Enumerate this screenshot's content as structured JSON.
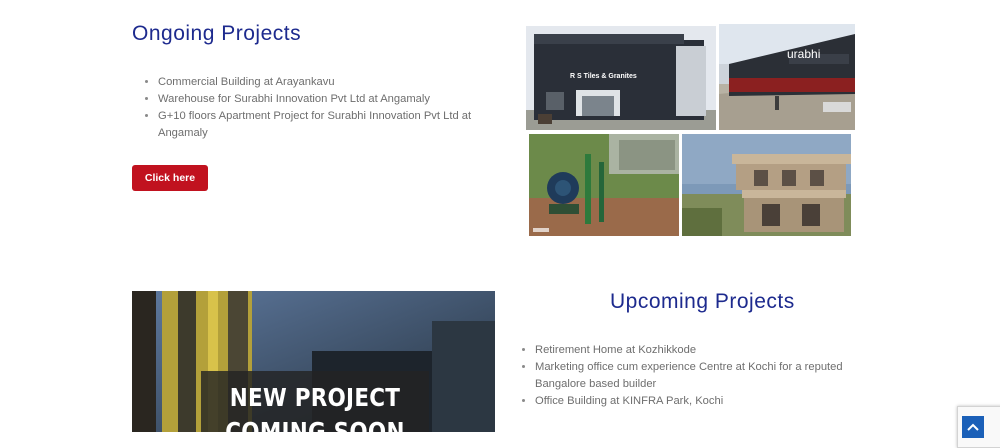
{
  "ongoing": {
    "title": "Ongoing Projects",
    "items": [
      "Commercial Building at Arayankavu",
      "Warehouse for Surabhi Innovation Pvt Ltd at Angamaly",
      "G+10 floors Apartment Project for Surabhi Innovation Pvt Ltd at Angamaly"
    ],
    "button_label": "Click here"
  },
  "gallery": {
    "showroom_sign": "R S Tiles & Granites",
    "showroom_side_sign": "urabhi"
  },
  "upcoming": {
    "title": "Upcoming Projects",
    "items": [
      "Retirement Home at Kozhikkode",
      "Marketing office cum experience Centre at Kochi for a reputed Bangalore based builder",
      "Office Building at KINFRA Park, Kochi"
    ],
    "banner_line1": "NEW PROJECT",
    "banner_line2": "COMING SOON"
  },
  "colors": {
    "title": "#1d2a8e",
    "button": "#c1121f",
    "back_to_top": "#1b60b8"
  },
  "icons": {
    "back_to_top": "chevron-up-icon"
  }
}
